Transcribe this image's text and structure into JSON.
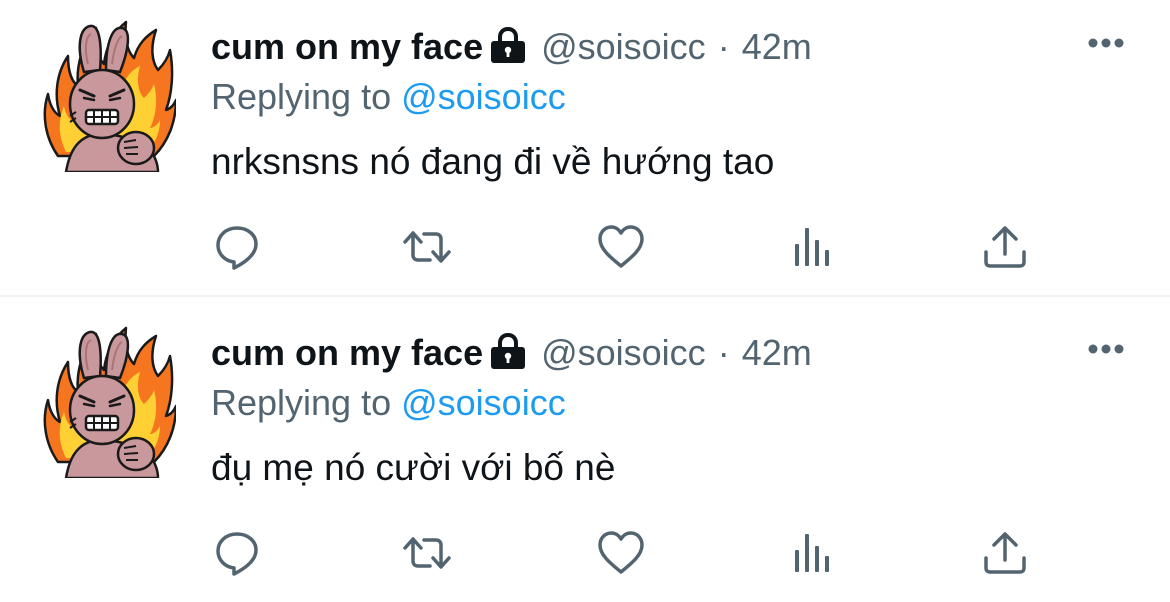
{
  "colors": {
    "text_primary": "#0f1419",
    "text_secondary": "#536471",
    "link": "#1d9bf0",
    "icon": "#536471",
    "divider": "#eff3f4"
  },
  "tweets": [
    {
      "display_name": "cum on my face",
      "handle": "@soisoicc",
      "separator": "·",
      "time": "42m",
      "protected_icon": "lock-icon",
      "replying_prefix": "Replying to",
      "replying_handle": "@soisoicc",
      "text": "nrksnsns nó đang đi về hướng tao",
      "actions": [
        "reply-icon",
        "retweet-icon",
        "like-icon",
        "views-icon",
        "share-icon"
      ]
    },
    {
      "display_name": "cum on my face",
      "handle": "@soisoicc",
      "separator": "·",
      "time": "42m",
      "protected_icon": "lock-icon",
      "replying_prefix": "Replying to",
      "replying_handle": "@soisoicc",
      "text": "đụ mẹ nó cười với bố nè",
      "actions": [
        "reply-icon",
        "retweet-icon",
        "like-icon",
        "views-icon",
        "share-icon"
      ]
    }
  ]
}
